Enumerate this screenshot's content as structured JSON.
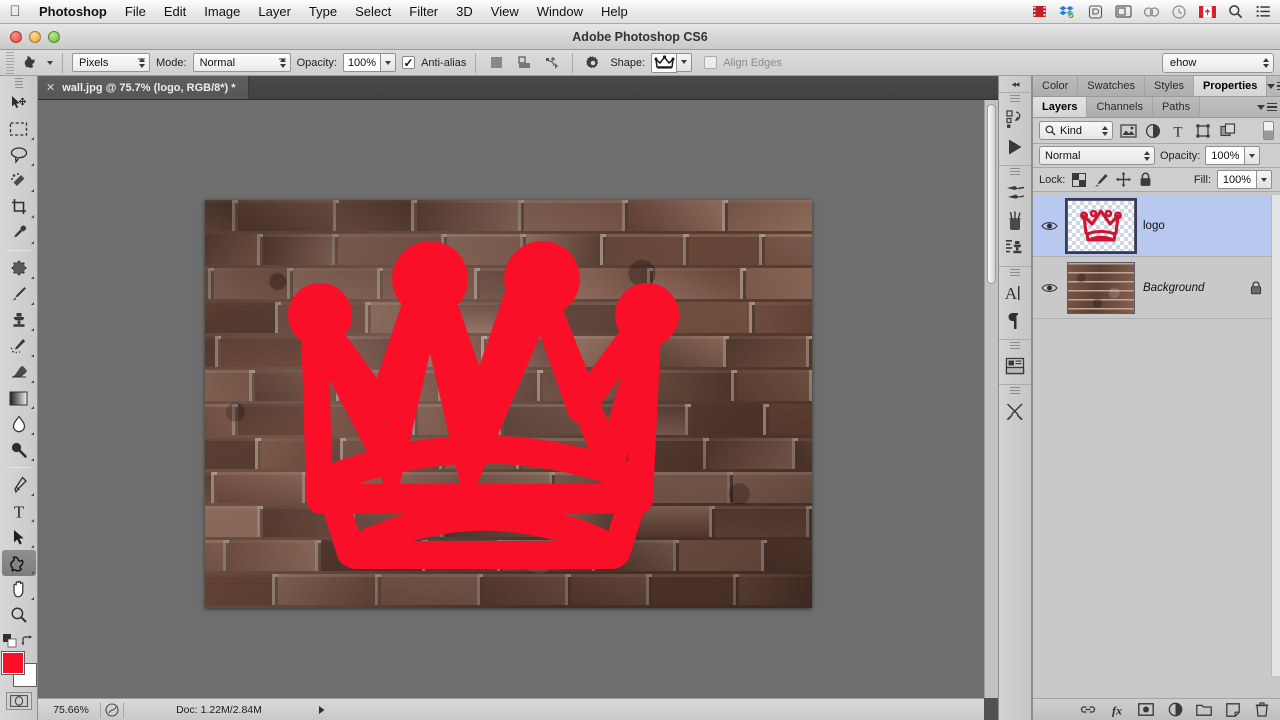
{
  "macbar": {
    "apple_icon": "apple-logo",
    "app_name": "Photoshop",
    "menus": [
      "File",
      "Edit",
      "Image",
      "Layer",
      "Type",
      "Select",
      "Filter",
      "3D",
      "View",
      "Window",
      "Help"
    ],
    "status_icons": [
      "screen-recorder-icon",
      "dropbox-icon",
      "app-icon",
      "display-icon",
      "creative-cloud-icon",
      "time-machine-icon",
      "canada-flag-icon",
      "spotlight-search-icon",
      "notification-center-icon"
    ]
  },
  "titlebar": {
    "title": "Adobe Photoshop CS6",
    "buttons": [
      "close-button",
      "minimize-button",
      "zoom-button"
    ]
  },
  "options_bar": {
    "tool_icon": "custom-shape-tool-icon",
    "mode_kind": "Pixels",
    "mode_label": "Mode:",
    "blend_mode": "Normal",
    "opacity_label": "Opacity:",
    "opacity_value": "100%",
    "antialias_label": "Anti-alias",
    "antialias_checked": true,
    "path_ops_icons": [
      "path-operations-icon",
      "path-alignment-icon",
      "path-arrangement-icon"
    ],
    "gear_icon": "geometry-options-gear-icon",
    "shape_label": "Shape:",
    "shape_preset": "crown-shape-icon",
    "align_edges_label": "Align Edges",
    "align_edges_checked": false,
    "workspace": "ehow"
  },
  "toolbox": {
    "tools": [
      {
        "name": "move-tool",
        "icon": "move-tool-icon",
        "selected": false,
        "hasflyout": false
      },
      {
        "name": "rectangular-marquee-tool",
        "icon": "marquee-tool-icon",
        "selected": false,
        "hasflyout": true
      },
      {
        "name": "lasso-tool",
        "icon": "lasso-tool-icon",
        "selected": false,
        "hasflyout": true
      },
      {
        "name": "quick-selection-tool",
        "icon": "quick-selection-tool-icon",
        "selected": false,
        "hasflyout": true
      },
      {
        "name": "crop-tool",
        "icon": "crop-tool-icon",
        "selected": false,
        "hasflyout": true
      },
      {
        "name": "eyedropper-tool",
        "icon": "eyedropper-tool-icon",
        "selected": false,
        "hasflyout": true
      },
      {
        "name": "spot-healing-brush-tool",
        "icon": "healing-brush-tool-icon",
        "selected": false,
        "hasflyout": true
      },
      {
        "name": "brush-tool",
        "icon": "brush-tool-icon",
        "selected": false,
        "hasflyout": true
      },
      {
        "name": "clone-stamp-tool",
        "icon": "clone-stamp-tool-icon",
        "selected": false,
        "hasflyout": true
      },
      {
        "name": "history-brush-tool",
        "icon": "history-brush-tool-icon",
        "selected": false,
        "hasflyout": true
      },
      {
        "name": "eraser-tool",
        "icon": "eraser-tool-icon",
        "selected": false,
        "hasflyout": true
      },
      {
        "name": "gradient-tool",
        "icon": "gradient-tool-icon",
        "selected": false,
        "hasflyout": true
      },
      {
        "name": "blur-tool",
        "icon": "blur-tool-icon",
        "selected": false,
        "hasflyout": true
      },
      {
        "name": "dodge-tool",
        "icon": "dodge-tool-icon",
        "selected": false,
        "hasflyout": true
      },
      {
        "name": "pen-tool",
        "icon": "pen-tool-icon",
        "selected": false,
        "hasflyout": true
      },
      {
        "name": "horizontal-type-tool",
        "icon": "type-tool-icon",
        "selected": false,
        "hasflyout": true
      },
      {
        "name": "path-selection-tool",
        "icon": "path-selection-tool-icon",
        "selected": false,
        "hasflyout": true
      },
      {
        "name": "custom-shape-tool",
        "icon": "custom-shape-tool-icon",
        "selected": true,
        "hasflyout": true
      },
      {
        "name": "hand-tool",
        "icon": "hand-tool-icon",
        "selected": false,
        "hasflyout": true
      },
      {
        "name": "zoom-tool",
        "icon": "zoom-tool-icon",
        "selected": false,
        "hasflyout": false
      }
    ],
    "foreground_color": "#fa0f28",
    "background_color": "#ffffff",
    "quickmask_icon": "quick-mask-icon",
    "default_colors_icon": "default-colors-icon",
    "swap_colors_icon": "swap-colors-icon"
  },
  "document": {
    "tab_label": "wall.jpg @ 75.7% (logo, RGB/8*) *",
    "tab_close_icon": "close-tab-icon",
    "cursor": "crosshair-cursor"
  },
  "statusbar": {
    "zoom": "75.66%",
    "preview_icon": "document-preview-icon",
    "doc_info": "Doc: 1.22M/2.84M",
    "arrow_icon": "status-menu-arrow-icon"
  },
  "icon_dock": {
    "collapse_icon": "collapse-panels-icon",
    "groups": [
      [
        "history-panel-icon",
        "actions-panel-icon"
      ],
      [
        "tool-presets-panel-icon",
        "brush-presets-panel-icon",
        "brush-panel-icon"
      ],
      [
        "character-panel-icon",
        "paragraph-panel-icon"
      ],
      [
        "layer-comps-panel-icon"
      ],
      [
        "adjustments-panel-icon"
      ]
    ]
  },
  "panels": {
    "top_tabs": [
      {
        "label": "Color",
        "active": false
      },
      {
        "label": "Swatches",
        "active": false
      },
      {
        "label": "Styles",
        "active": false
      },
      {
        "label": "Properties",
        "active": true
      }
    ],
    "layer_tabs": [
      {
        "label": "Layers",
        "active": true
      },
      {
        "label": "Channels",
        "active": false
      },
      {
        "label": "Paths",
        "active": false
      }
    ],
    "menu_icon": "panel-menu-icon",
    "filter": {
      "search_icon": "filter-search-icon",
      "kind": "Kind",
      "filter_icons": [
        "filter-pixel-layers-icon",
        "filter-adjustment-layers-icon",
        "filter-type-layers-icon",
        "filter-shape-layers-icon",
        "filter-smart-objects-icon"
      ],
      "toggle_icon": "filter-toggle-switch"
    },
    "blend_mode": "Normal",
    "opacity_label": "Opacity:",
    "opacity_value": "100%",
    "lock_label": "Lock:",
    "lock_icons": [
      "lock-transparent-pixels-icon",
      "lock-image-pixels-icon",
      "lock-position-icon",
      "lock-all-icon"
    ],
    "fill_label": "Fill:",
    "fill_value": "100%",
    "layers": [
      {
        "name": "logo",
        "visible": true,
        "selected": true,
        "locked": false,
        "italic": false,
        "thumb": "crown-logo-thumbnail"
      },
      {
        "name": "Background",
        "visible": true,
        "selected": false,
        "locked": true,
        "italic": true,
        "thumb": "brick-wall-thumbnail"
      }
    ],
    "footer_icons": [
      "link-layers-icon",
      "add-layer-style-icon",
      "add-layer-mask-icon",
      "new-adjustment-layer-icon",
      "new-group-icon",
      "new-layer-icon",
      "delete-layer-icon"
    ]
  },
  "colors": {
    "accent_red": "#fa0f28",
    "selection_blue": "#b8c8ee",
    "panel_gray": "#c8c8c8",
    "canvas_backdrop": "#6e6e6e"
  }
}
